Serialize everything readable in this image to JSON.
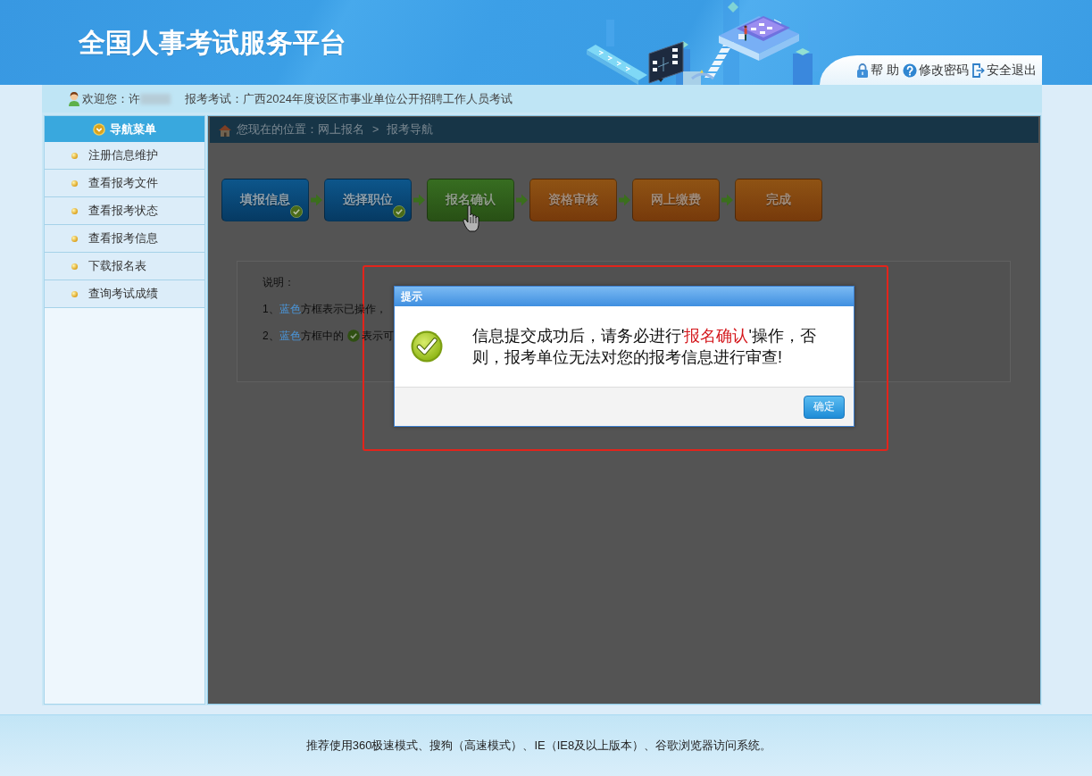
{
  "header": {
    "title": "全国人事考试服务平台",
    "links": [
      "帮 助",
      "修改密码",
      "安全退出"
    ]
  },
  "info_bar": {
    "welcome": "欢迎您：许",
    "exam": "报考考试：广西2024年度设区市事业单位公开招聘工作人员考试"
  },
  "sidebar": {
    "title": "导航菜单",
    "items": [
      {
        "label": "注册信息维护",
        "selected": false
      },
      {
        "label": "查看报考文件",
        "selected": false
      },
      {
        "label": "查看报考状态",
        "selected": false
      },
      {
        "label": "查看报考信息",
        "selected": false
      },
      {
        "label": "下载报名表",
        "selected": false
      },
      {
        "label": "查询考试成绩",
        "selected": false
      }
    ]
  },
  "breadcrumb": {
    "label": "您现在的位置：",
    "items": [
      "网上报名",
      "报考导航"
    ],
    "separator": ">"
  },
  "steps": [
    {
      "label": "填报信息",
      "completed": true,
      "active": false,
      "hovered": false
    },
    {
      "label": "选择职位",
      "completed": true,
      "active": false,
      "hovered": false
    },
    {
      "label": "报名确认",
      "completed": false,
      "active": true,
      "hovered": true
    },
    {
      "label": "资格审核",
      "completed": false,
      "active": false,
      "hovered": false
    },
    {
      "label": "网上缴费",
      "completed": false,
      "active": false,
      "hovered": false
    },
    {
      "label": "完成",
      "completed": false,
      "active": false,
      "hovered": false
    }
  ],
  "notes": {
    "title": "说明：",
    "lines": [
      {
        "text": [
          {
            "text": "1、",
            "highlighted": false
          },
          {
            "text": "蓝色",
            "highlighted": true
          },
          {
            "text": "方框表示已操作，",
            "highlighted": false
          }
        ],
        "check_icon": false
      },
      {
        "text": [
          {
            "text": "2、",
            "highlighted": false
          },
          {
            "text": "蓝色",
            "highlighted": true
          },
          {
            "text": "方框中的",
            "highlighted": false
          }
        ],
        "check_icon": true,
        "text_after_icon": [
          {
            "text": "表示可",
            "highlighted": false
          }
        ]
      }
    ]
  },
  "dialog": {
    "title": "提示",
    "message": [
      {
        "text": "信息提交成功后，请务必进行'",
        "highlighted": false
      },
      {
        "text": "报名确认",
        "highlighted": true
      },
      {
        "text": "'操作，否则，报考单位无法对您的报考信息进行审查!",
        "highlighted": false
      }
    ],
    "button": "确定"
  },
  "footer": {
    "text": "推荐使用360极速模式、搜狗（高速模式）、IE（IE8及以上版本）、谷歌浏览器访问系统。"
  }
}
